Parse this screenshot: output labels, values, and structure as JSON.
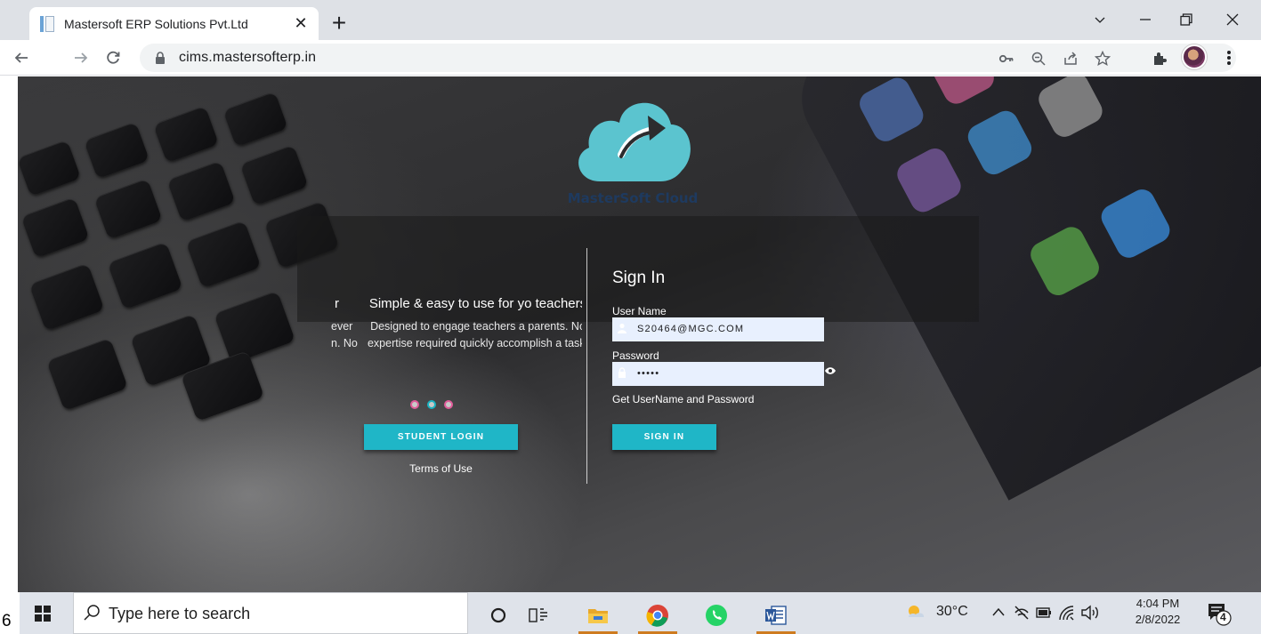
{
  "browser": {
    "tab_title": "Mastersoft ERP Solutions Pvt.Ltd",
    "url": "cims.mastersofterp.in",
    "tab_close_glyph": "✕",
    "new_tab_glyph": "+"
  },
  "page": {
    "logo_text": "MasterSoft Cloud",
    "slider": {
      "prev_title": "r",
      "prev_desc_1": "ever",
      "prev_desc_2": "n. No",
      "title": "Simple & easy to use for yo teachers",
      "desc": "Designed to engage teachers a parents. No expertise required quickly accomplish a task."
    },
    "student_login_label": "STUDENT LOGIN",
    "terms_label": "Terms of Use",
    "signin": {
      "title": "Sign In",
      "username_label": "User Name",
      "username_value": "S20464@MGC.COM",
      "password_label": "Password",
      "password_value": "•••••",
      "get_credentials_link": "Get UserName and Password",
      "submit_label": "SIGN IN"
    },
    "colors": {
      "accent": "#1fb6c7",
      "logo_cloud": "#5bc4cf",
      "logo_text": "#1e3a5f",
      "dot_border": "#e05c9a"
    }
  },
  "taskbar": {
    "stray_char": "6",
    "search_placeholder": "Type here to search",
    "weather_temp": "30°C",
    "time": "4:04 PM",
    "date": "2/8/2022",
    "notification_count": "4"
  }
}
